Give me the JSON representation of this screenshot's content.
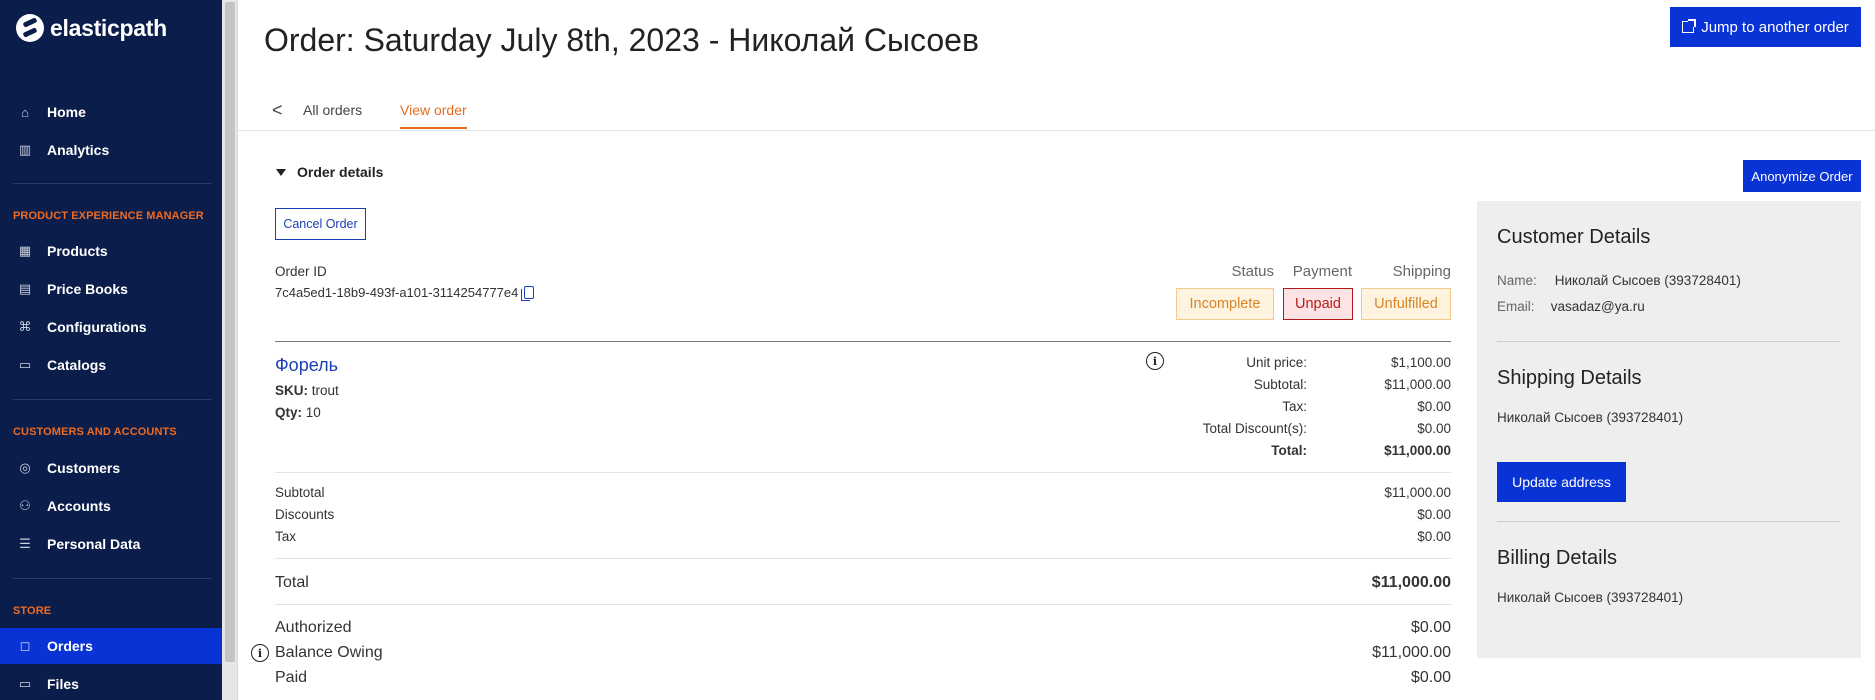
{
  "sidebar": {
    "brand": "elasticpath",
    "items": [
      {
        "label": "Home",
        "icon": "home-icon",
        "glyph": "⌂"
      },
      {
        "label": "Analytics",
        "icon": "analytics-icon",
        "glyph": "▥"
      }
    ],
    "pxm_section": "PRODUCT EXPERIENCE MANAGER",
    "pxm_items": [
      {
        "label": "Products",
        "icon": "products-icon",
        "glyph": "▦"
      },
      {
        "label": "Price Books",
        "icon": "price-books-icon",
        "glyph": "▤"
      },
      {
        "label": "Configurations",
        "icon": "configurations-icon",
        "glyph": "⌘"
      },
      {
        "label": "Catalogs",
        "icon": "catalogs-icon",
        "glyph": "▭"
      }
    ],
    "customers_section": "CUSTOMERS AND ACCOUNTS",
    "customers_items": [
      {
        "label": "Customers",
        "icon": "customers-icon",
        "glyph": "◎"
      },
      {
        "label": "Accounts",
        "icon": "accounts-icon",
        "glyph": "⚇"
      },
      {
        "label": "Personal Data",
        "icon": "personal-data-icon",
        "glyph": "☰"
      }
    ],
    "store_section": "STORE",
    "store_items": [
      {
        "label": "Orders",
        "icon": "orders-icon",
        "glyph": "◻",
        "active": true
      },
      {
        "label": "Files",
        "icon": "files-icon",
        "glyph": "▭"
      }
    ]
  },
  "header": {
    "title": "Order: Saturday July 8th, 2023 - Николай Сысоев",
    "jump_button": "Jump to another order"
  },
  "tabs": {
    "back": "<",
    "all_orders": "All orders",
    "view_order": "View order"
  },
  "order": {
    "section_title": "Order details",
    "cancel_button": "Cancel Order",
    "id_label": "Order ID",
    "id_value": "7c4a5ed1-18b9-493f-a101-3114254777e4",
    "status_headers": {
      "status": "Status",
      "payment": "Payment",
      "shipping": "Shipping"
    },
    "badges": {
      "status": "Incomplete",
      "payment": "Unpaid",
      "shipping": "Unfulfilled"
    },
    "item": {
      "name": "Форель",
      "sku_label": "SKU:",
      "sku": "trout",
      "qty_label": "Qty:",
      "qty": "10",
      "unit_price_label": "Unit price:",
      "unit_price": "$1,100.00",
      "subtotal_label": "Subtotal:",
      "subtotal": "$11,000.00",
      "tax_label": "Tax:",
      "tax": "$0.00",
      "discounts_label": "Total Discount(s):",
      "discounts": "$0.00",
      "total_label": "Total:",
      "total": "$11,000.00"
    },
    "summary": {
      "subtotal_label": "Subtotal",
      "subtotal": "$11,000.00",
      "discounts_label": "Discounts",
      "discounts": "$0.00",
      "tax_label": "Tax",
      "tax": "$0.00",
      "total_label": "Total",
      "total": "$11,000.00",
      "authorized_label": "Authorized",
      "authorized": "$0.00",
      "balance_label": "Balance Owing",
      "balance": "$11,000.00",
      "paid_label": "Paid",
      "paid": "$0.00"
    }
  },
  "details": {
    "anonymize_button": "Anonymize Order",
    "customer_title": "Customer Details",
    "name_label": "Name:",
    "name_value": "Николай Сысоев (393728401)",
    "email_label": "Email:",
    "email_value": "vasadaz@ya.ru",
    "shipping_title": "Shipping Details",
    "shipping_value": "Николай Сысоев (393728401)",
    "update_button": "Update address",
    "billing_title": "Billing Details",
    "billing_value": "Николай Сысоев (393728401)"
  },
  "colors": {
    "sidebar_bg": "#0b1d4a",
    "primary": "#0a33d6",
    "accent": "#e56b1f",
    "link": "#1b3fb5"
  }
}
